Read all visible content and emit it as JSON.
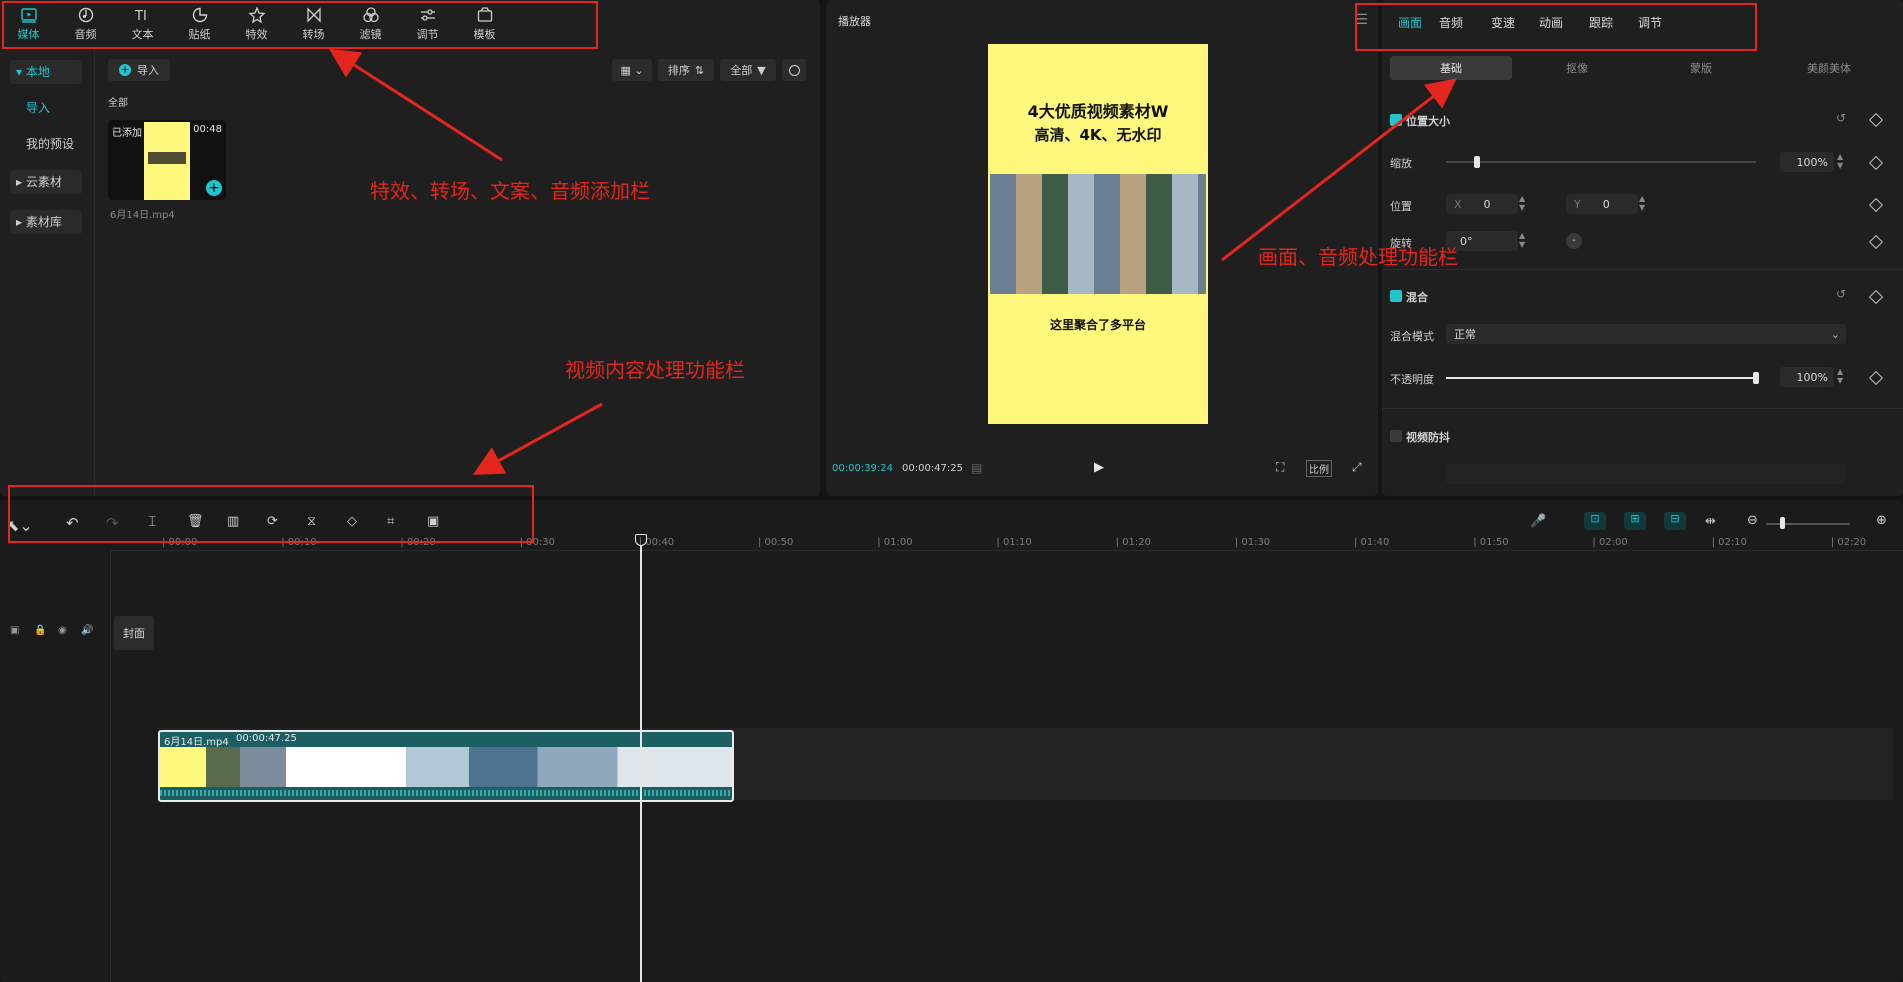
{
  "media_panel": {
    "tabs": [
      {
        "label": "媒体",
        "icon": "media-icon"
      },
      {
        "label": "音频",
        "icon": "audio-icon"
      },
      {
        "label": "文本",
        "icon": "text-icon"
      },
      {
        "label": "贴纸",
        "icon": "sticker-icon"
      },
      {
        "label": "特效",
        "icon": "effects-icon"
      },
      {
        "label": "转场",
        "icon": "transition-icon"
      },
      {
        "label": "滤镜",
        "icon": "filter-icon"
      },
      {
        "label": "调节",
        "icon": "adjust-icon"
      },
      {
        "label": "模板",
        "icon": "template-icon"
      }
    ],
    "sidebar": {
      "local": "本地",
      "import": "导入",
      "my_presets": "我的预设",
      "cloud": "云素材",
      "library": "素材库"
    },
    "import_button": "导入",
    "sort_label": "排序",
    "filter_label": "全部",
    "section_all": "全部",
    "thumb": {
      "added_badge": "已添加",
      "duration": "00:48",
      "filename": "6月14日.mp4"
    }
  },
  "player": {
    "title": "播放器",
    "preview": {
      "headline_line1": "4大优质视频素材W",
      "headline_line2": "高清、4K、无水印",
      "footer_text": "这里聚合了多平台"
    },
    "current_time": "00:00:39:24",
    "total_time": "00:00:47:25",
    "ratio_label": "比例"
  },
  "properties": {
    "tabs": [
      "画面",
      "音频",
      "变速",
      "动画",
      "跟踪",
      "调节"
    ],
    "subtabs": [
      "基础",
      "抠像",
      "蒙版",
      "美颜美体"
    ],
    "section_position": "位置大小",
    "scale_label": "缩放",
    "scale_value": "100%",
    "scale_fraction": 0.1,
    "position_label": "位置",
    "x_label": "X",
    "x_value": "0",
    "y_label": "Y",
    "y_value": "0",
    "rotation_label": "旋转",
    "rotation_value": "0°",
    "section_blend": "混合",
    "blend_mode_label": "混合模式",
    "blend_mode_value": "正常",
    "opacity_label": "不透明度",
    "opacity_value": "100%",
    "opacity_fraction": 1.0,
    "section_stabilize": "视频防抖"
  },
  "timeline": {
    "ruler_labels": [
      "00:00",
      "00:10",
      "00:20",
      "00:30",
      "00:40",
      "00:50",
      "01:00",
      "01:10",
      "01:20",
      "01:30",
      "01:40",
      "01:50",
      "02:00",
      "02:10",
      "02:20"
    ],
    "clip_name": "6月14日.mp4",
    "clip_duration": "00:00:47.25",
    "cover_label": "封面"
  },
  "annotations": {
    "top_toolbar": "特效、转场、文案、音频添加栏",
    "right_panel": "画面、音频处理功能栏",
    "timeline_toolbar": "视频内容处理功能栏"
  },
  "colors": {
    "accent": "#21c5cf",
    "annotation": "#e5261f",
    "preview_bg": "#fef87c",
    "clip_bg": "#1b5f63"
  }
}
